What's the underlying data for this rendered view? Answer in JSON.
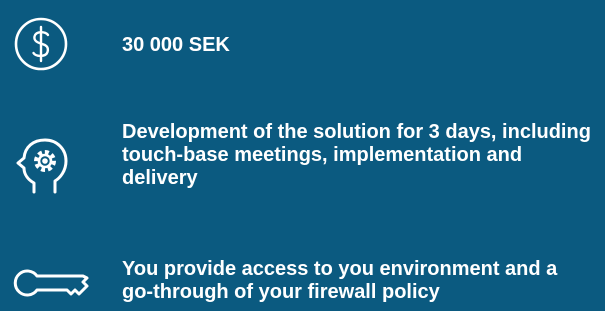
{
  "items": [
    {
      "icon": "dollar-circle-icon",
      "text": "30 000 SEK"
    },
    {
      "icon": "head-gear-icon",
      "text": "Development of the solution for 3 days, including touch-base meetings, implementation and delivery"
    },
    {
      "icon": "key-icon",
      "text": "You provide access to you environment and a go-through of your firewall policy"
    }
  ],
  "colors": {
    "background": "#0b5a80",
    "foreground": "#ffffff"
  }
}
